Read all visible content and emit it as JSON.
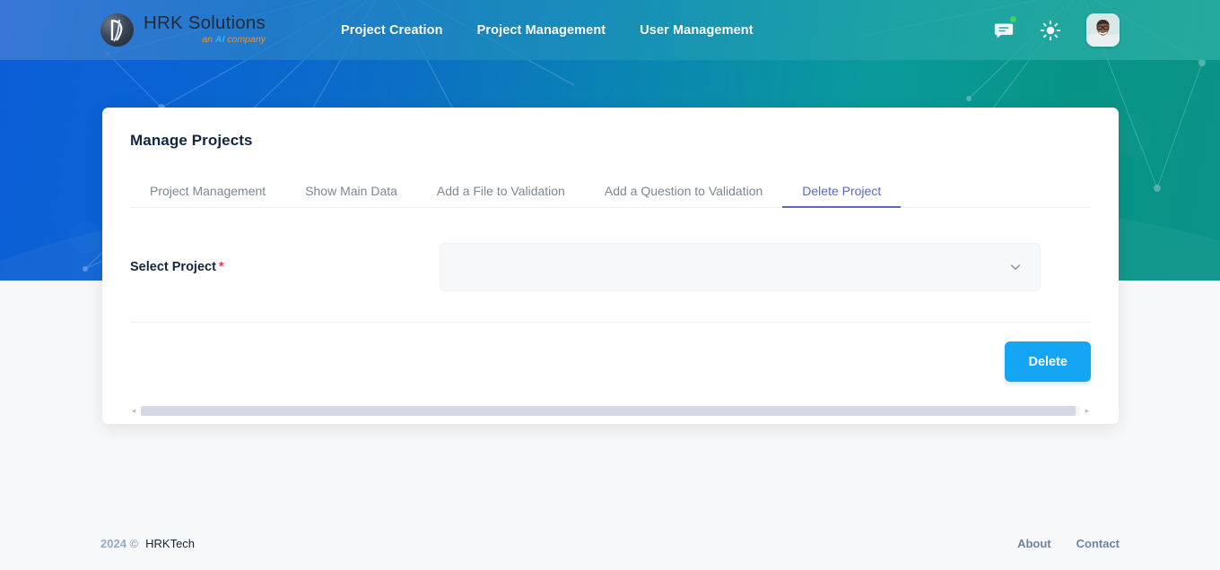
{
  "navbar": {
    "brand": {
      "title": "HRK Solutions",
      "tagline_pre": "an ",
      "tagline_ai": "AI",
      "tagline_post": " company",
      "logo_icon": "hrk-logo-icon"
    },
    "links": [
      {
        "label": "Project Creation",
        "name": "nav-link-project-creation"
      },
      {
        "label": "Project Management",
        "name": "nav-link-project-management"
      },
      {
        "label": "User Management",
        "name": "nav-link-user-management"
      }
    ],
    "actions": {
      "messages_icon": "message-icon",
      "messages_badge": true,
      "theme_icon": "sun-icon",
      "avatar_icon": "user-avatar"
    }
  },
  "card": {
    "title": "Manage Projects",
    "tabs": [
      {
        "label": "Project Management",
        "active": false
      },
      {
        "label": "Show Main Data",
        "active": false
      },
      {
        "label": "Add a File to Validation",
        "active": false
      },
      {
        "label": "Add a Question to Validation",
        "active": false
      },
      {
        "label": "Delete Project",
        "active": true
      }
    ],
    "form": {
      "select_project_label": "Select Project",
      "required_marker": "*",
      "select_project_value": "",
      "select_project_placeholder": "",
      "dropdown_icon": "chevron-down-icon"
    },
    "delete_button": "Delete",
    "scrollbar": {
      "left_arrow": "◂",
      "right_arrow": "▸"
    }
  },
  "footer": {
    "year": "2024 ©",
    "company": "HRKTech",
    "links": [
      {
        "label": "About"
      },
      {
        "label": "Contact"
      }
    ]
  },
  "colors": {
    "hero_blue": "#0a63d4",
    "hero_teal": "#0a9388",
    "accent_tab": "#5969c8",
    "delete_button": "#15a5f5",
    "required_star": "#f5365c",
    "badge_green": "#3fd35f"
  }
}
